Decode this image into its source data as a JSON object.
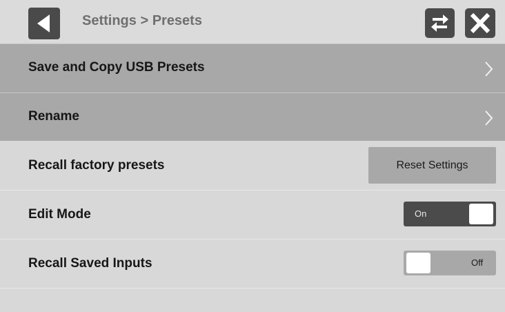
{
  "header": {
    "title": "Settings > Presets",
    "back_icon": "triangle-left-icon",
    "swap_icon": "swap-arrows-icon",
    "close_icon": "close-x-icon"
  },
  "menu": {
    "save_copy_usb": "Save and Copy USB Presets",
    "rename": "Rename",
    "chevron_icon": "chevron-right-icon"
  },
  "settings": {
    "recall_factory": {
      "label": "Recall factory presets",
      "button": "Reset Settings"
    },
    "edit_mode": {
      "label": "Edit Mode",
      "state": "On"
    },
    "recall_saved_inputs": {
      "label": "Recall Saved Inputs",
      "state": "Off"
    }
  },
  "colors": {
    "background": "#d9d8d9",
    "nav_row": "#a9a8a9",
    "button_dark": "#4a4a4a",
    "toggle_on": "#4b4b4b",
    "toggle_off": "#a9a8a9"
  }
}
